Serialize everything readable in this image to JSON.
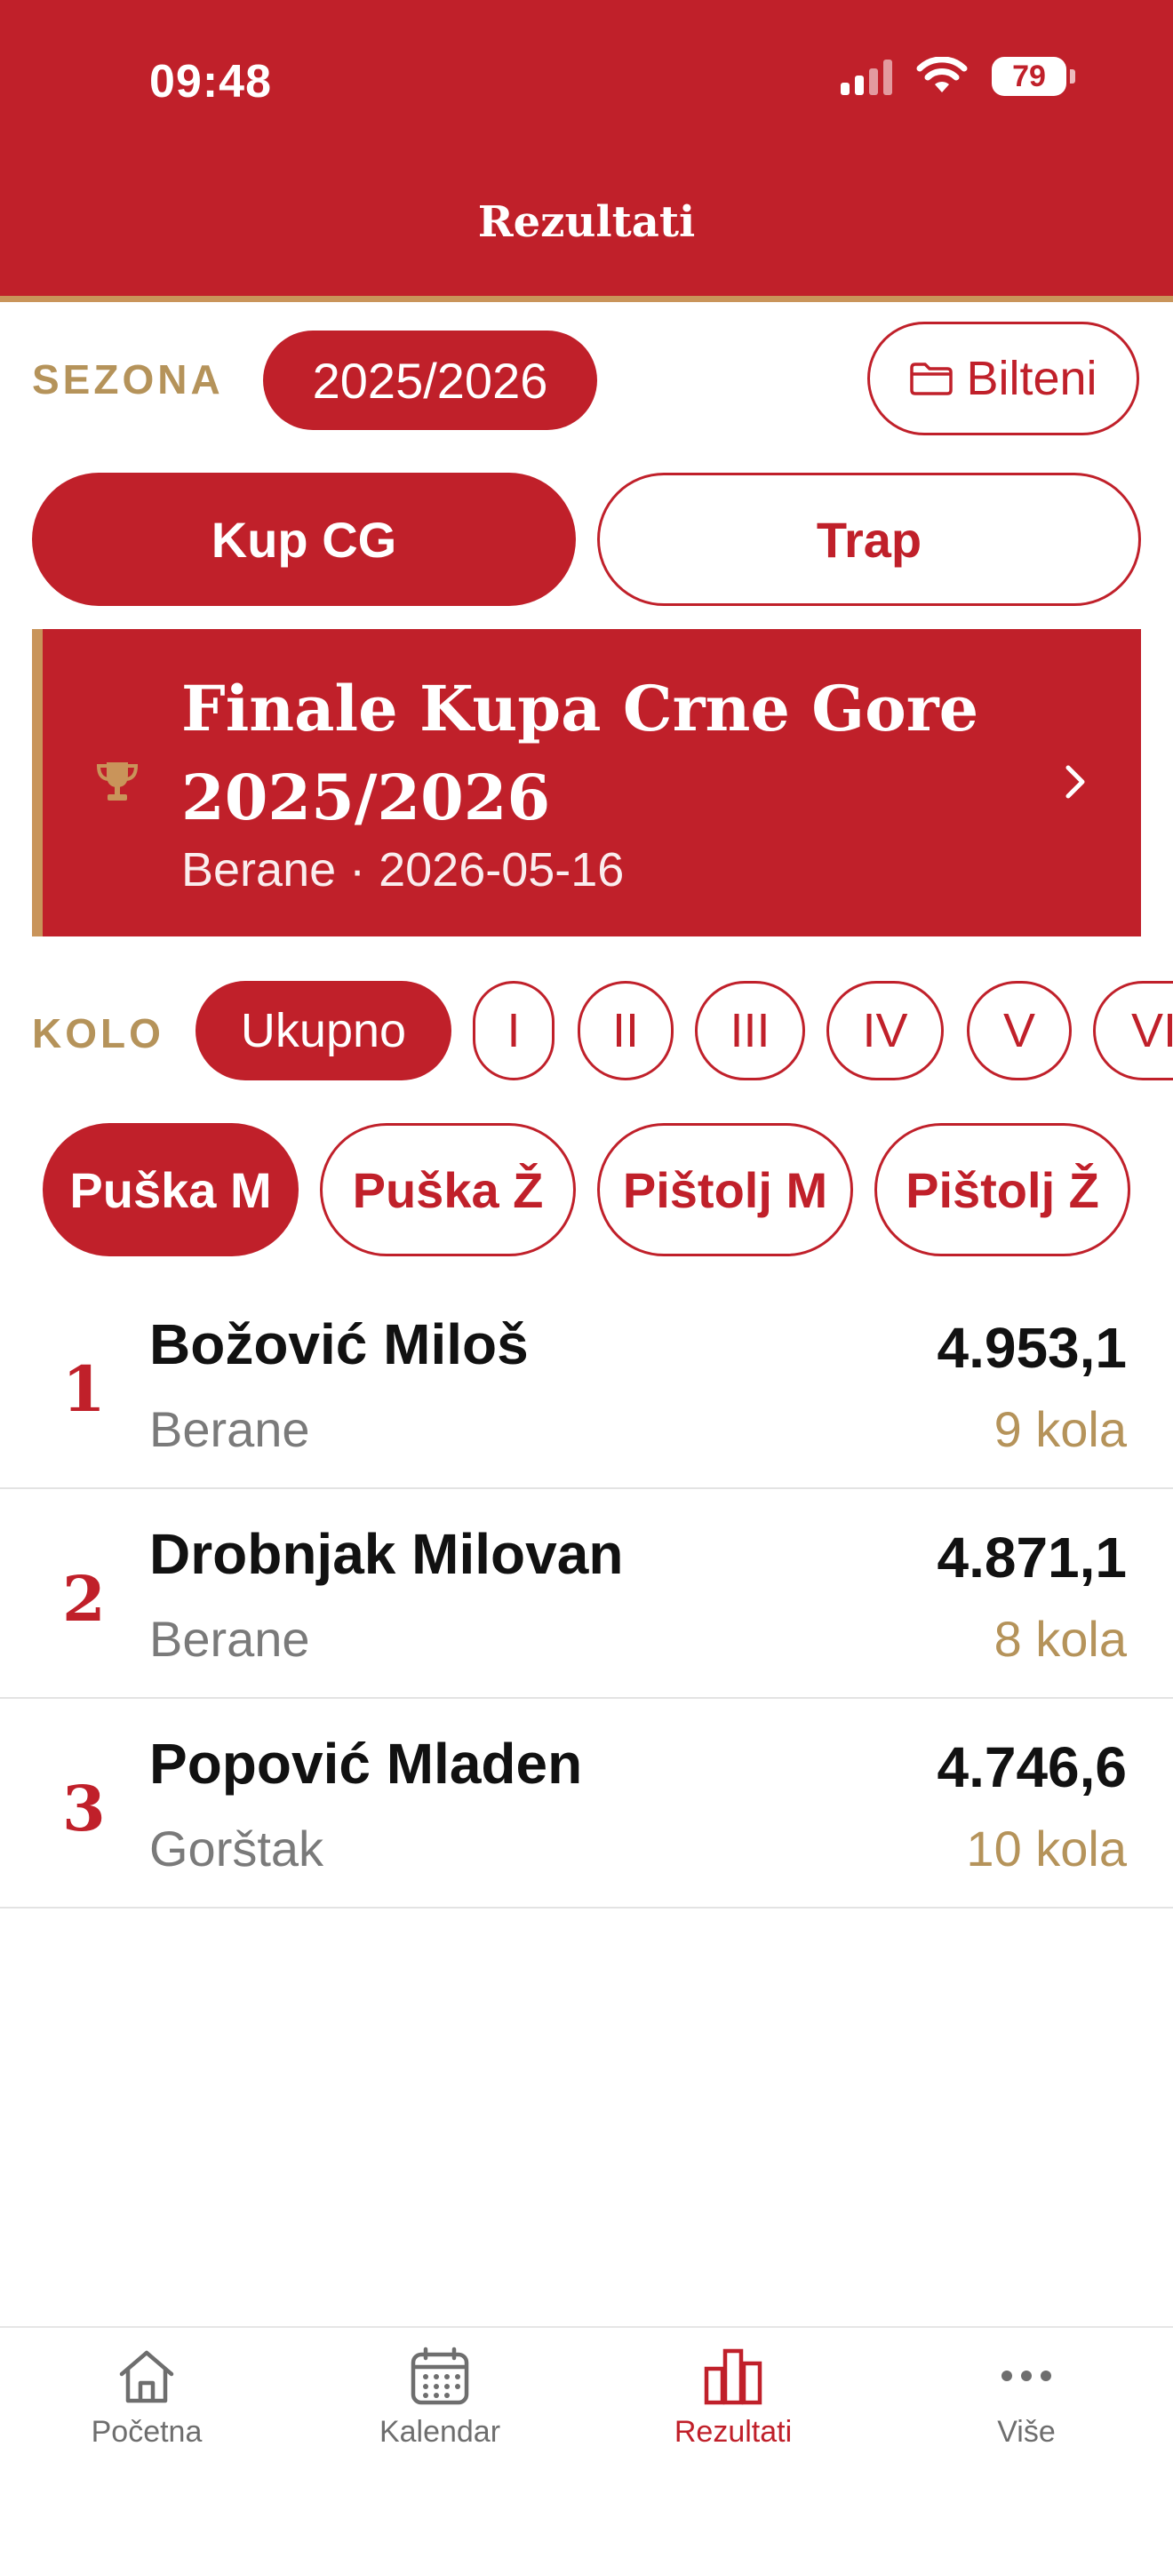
{
  "status_bar": {
    "time": "09:48",
    "battery": "79"
  },
  "header": {
    "title": "Rezultati"
  },
  "season": {
    "label": "SEZONA",
    "value": "2025/2026",
    "bulletins_label": "Bilteni"
  },
  "competitions": [
    {
      "label": "Kup CG",
      "active": true
    },
    {
      "label": "Trap",
      "active": false
    }
  ],
  "event": {
    "title_line1": "Finale Kupa Crne Gore",
    "title_line2": "2025/2026",
    "subtitle": "Berane · 2026-05-16"
  },
  "kolo": {
    "label": "KOLO",
    "items": [
      "Ukupno",
      "I",
      "II",
      "III",
      "IV",
      "V",
      "VI"
    ]
  },
  "disciplines": [
    "Puška M",
    "Puška Ž",
    "Pištolj M",
    "Pištolj Ž"
  ],
  "results": [
    {
      "rank": "1",
      "name": "Božović Miloš",
      "club": "Berane",
      "score": "4.953,1",
      "rounds": "9 kola"
    },
    {
      "rank": "2",
      "name": "Drobnjak Milovan",
      "club": "Berane",
      "score": "4.871,1",
      "rounds": "8 kola"
    },
    {
      "rank": "3",
      "name": "Popović Mladen",
      "club": "Gorštak",
      "score": "4.746,6",
      "rounds": "10 kola"
    }
  ],
  "tabs": [
    {
      "label": "Početna",
      "icon": "home-icon"
    },
    {
      "label": "Kalendar",
      "icon": "calendar-icon"
    },
    {
      "label": "Rezultati",
      "icon": "chart-icon"
    },
    {
      "label": "Više",
      "icon": "more-icon"
    }
  ],
  "colors": {
    "primary": "#C0202A",
    "gold": "#B5935A",
    "accent_border": "#C9945A"
  }
}
